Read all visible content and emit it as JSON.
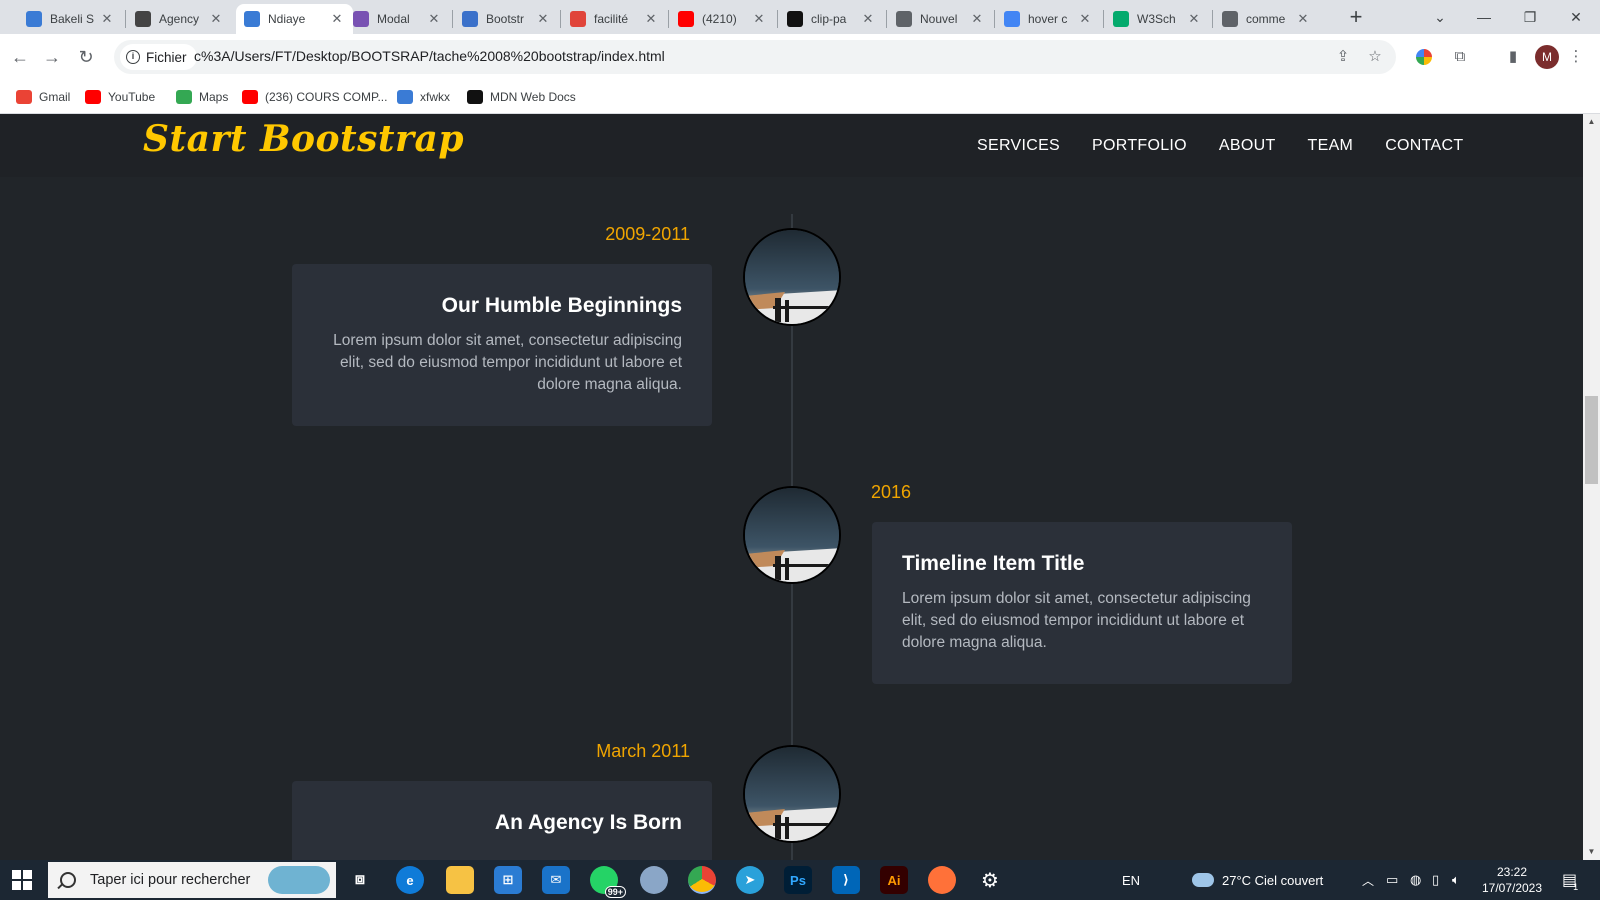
{
  "browser": {
    "tabs": [
      {
        "label": "Bakeli S",
        "icon": "bakeli-icon",
        "color": "#3a7bd5"
      },
      {
        "label": "Agency",
        "icon": "globe-icon",
        "color": "#444"
      },
      {
        "label": "Ndiaye",
        "icon": "bakeli-icon",
        "color": "#3a7bd5",
        "active": true
      },
      {
        "label": "Modal",
        "icon": "bootstrap-icon",
        "color": "#7952b3"
      },
      {
        "label": "Bootstr",
        "icon": "mdb-icon",
        "color": "#3b71ca"
      },
      {
        "label": "facilité",
        "icon": "asterisk-icon",
        "color": "#e0443a"
      },
      {
        "label": "(4210)",
        "icon": "youtube-icon",
        "color": "#ff0000"
      },
      {
        "label": "clip-pa",
        "icon": "mdn-icon",
        "color": "#111"
      },
      {
        "label": "Nouvel",
        "icon": "chrome-icon",
        "color": "#5f6368"
      },
      {
        "label": "hover c",
        "icon": "google-icon",
        "color": "#4285f4"
      },
      {
        "label": "W3Sch",
        "icon": "w3schools-icon",
        "color": "#04aa6d"
      },
      {
        "label": "comme",
        "icon": "globe-icon",
        "color": "#5f6368"
      }
    ],
    "chip_label": "Fichier",
    "url": "c%3A/Users/FT/Desktop/BOOTSRAP/tache%2008%20bootstrap/index.html",
    "profile_initial": "M",
    "bookmarks": [
      {
        "label": "Gmail",
        "color": "#ea4335",
        "icon": "gmail-icon"
      },
      {
        "label": "YouTube",
        "color": "#ff0000",
        "icon": "youtube-icon"
      },
      {
        "label": "Maps",
        "color": "#34a853",
        "icon": "maps-icon"
      },
      {
        "label": "(236) COURS COMP...",
        "color": "#ff0000",
        "icon": "youtube-icon"
      },
      {
        "label": "xfwkx",
        "color": "#3a7bd5",
        "icon": "bakeli-icon"
      },
      {
        "label": "MDN Web Docs",
        "color": "#111111",
        "icon": "mdn-icon"
      }
    ]
  },
  "site": {
    "brand": "Start Bootstrap",
    "nav": [
      "SERVICES",
      "PORTFOLIO",
      "ABOUT",
      "TEAM",
      "CONTACT"
    ],
    "timeline": [
      {
        "date": "2009-2011",
        "title": "Our Humble Beginnings",
        "text": "Lorem ipsum dolor sit amet, consectetur adipiscing elit, sed do eiusmod tempor incididunt ut labore et dolore magna aliqua.",
        "side": "left"
      },
      {
        "date": "2016",
        "title": "Timeline Item Title",
        "text": "Lorem ipsum dolor sit amet, consectetur adipiscing elit, sed do eiusmod tempor incididunt ut labore et dolore magna aliqua.",
        "side": "right"
      },
      {
        "date": "March 2011",
        "title": "An Agency Is Born",
        "text": "",
        "side": "left"
      }
    ],
    "accent_color": "#ffc800",
    "date_color": "#f0a500"
  },
  "taskbar": {
    "search_placeholder": "Taper ici pour rechercher",
    "language": "EN",
    "weather": "27°C  Ciel couvert",
    "time": "23:22",
    "date": "17/07/2023",
    "whatsapp_badge": "99+",
    "notification_count": "1"
  }
}
